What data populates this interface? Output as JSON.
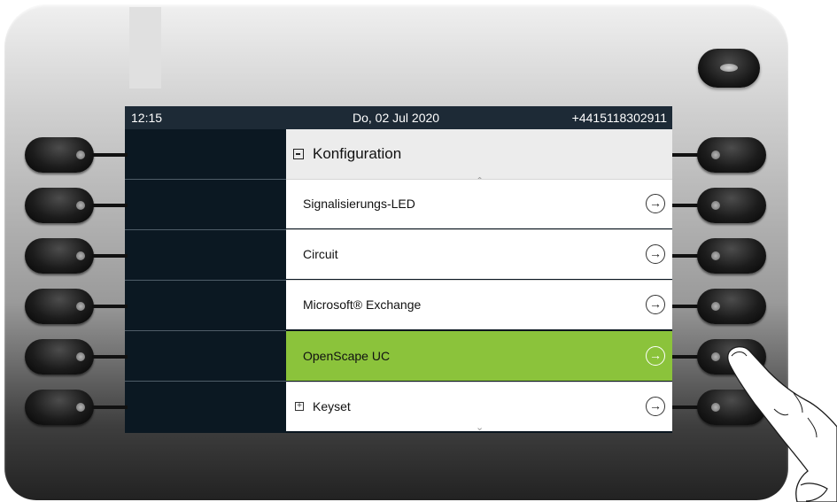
{
  "statusbar": {
    "time": "12:15",
    "date": "Do, 02 Jul 2020",
    "phone_number": "+4415118302911"
  },
  "menu": {
    "title": "Konfiguration",
    "items": [
      {
        "label": "Signalisierungs-LED",
        "icon": "arrow-right-icon",
        "selected": false
      },
      {
        "label": "Circuit",
        "icon": "arrow-right-icon",
        "selected": false
      },
      {
        "label": "Microsoft® Exchange",
        "icon": "arrow-right-icon",
        "selected": false
      },
      {
        "label": "OpenScape UC",
        "icon": "arrow-right-icon",
        "selected": true
      },
      {
        "label": "Keyset",
        "icon": "arrow-right-icon",
        "selected": false,
        "expandable": true
      }
    ]
  },
  "colors": {
    "selected_row": "#8bc33b",
    "header_bg": "#ececec",
    "statusbar_bg": "#1d2a36",
    "screen_bg": "#0a1620"
  },
  "hardware": {
    "left_softkeys": 6,
    "right_softkeys": 6,
    "top_key": "led-key",
    "pointer": "finger-pointing-hand-icon"
  }
}
